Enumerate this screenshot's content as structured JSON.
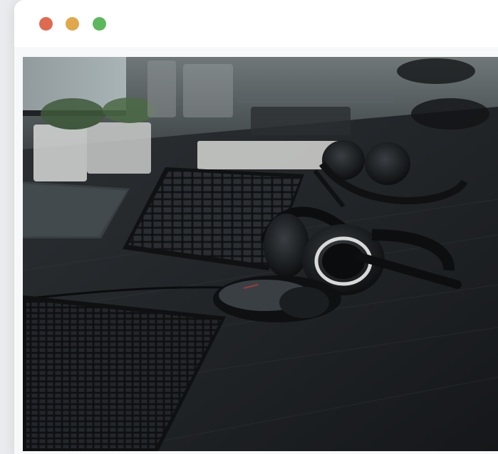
{
  "window": {
    "controls": [
      {
        "name": "close",
        "color": "#e06a50"
      },
      {
        "name": "minimize",
        "color": "#e0a84a"
      },
      {
        "name": "maximize",
        "color": "#5cb85c"
      }
    ]
  },
  "photo": {
    "subject_icons": [
      "keyboard-icon",
      "headset-icon",
      "mouse-icon"
    ]
  }
}
